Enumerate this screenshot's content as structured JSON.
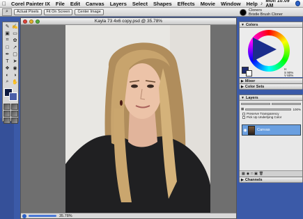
{
  "menubar": {
    "apple": "",
    "app_name": "Corel Painter IX",
    "items": [
      "File",
      "Edit",
      "Canvas",
      "Layers",
      "Select",
      "Shapes",
      "Effects",
      "Movie",
      "Window",
      "Help"
    ],
    "clock": "Mon 10:09 AM"
  },
  "propbar": {
    "buttons": [
      "Actual Pixels",
      "Fit On Screen",
      "Center Image"
    ],
    "brush_category": "Cloners",
    "brush_variant": "Bristle Brush Cloner"
  },
  "document": {
    "title": "Kayla 73 4x6 copy.psd @ 35.78%",
    "zoom": "35.78%"
  },
  "palettes": {
    "colors": "Colors",
    "hsv": [
      "H",
      "S 90%",
      "V 60%"
    ],
    "mixer": "Mixer",
    "color_sets": "Color Sets",
    "layers": "Layers",
    "opacity": "100%",
    "preserve_transparency": "Preserve Transparency",
    "pick_up_underlying": "Pick Up Underlying Color",
    "layer_name": "Canvas",
    "channels": "Channels"
  },
  "colors": {
    "primary": "#1c2a70",
    "secondary": "#ffffff",
    "layer_selected": "#6a9fe0"
  }
}
